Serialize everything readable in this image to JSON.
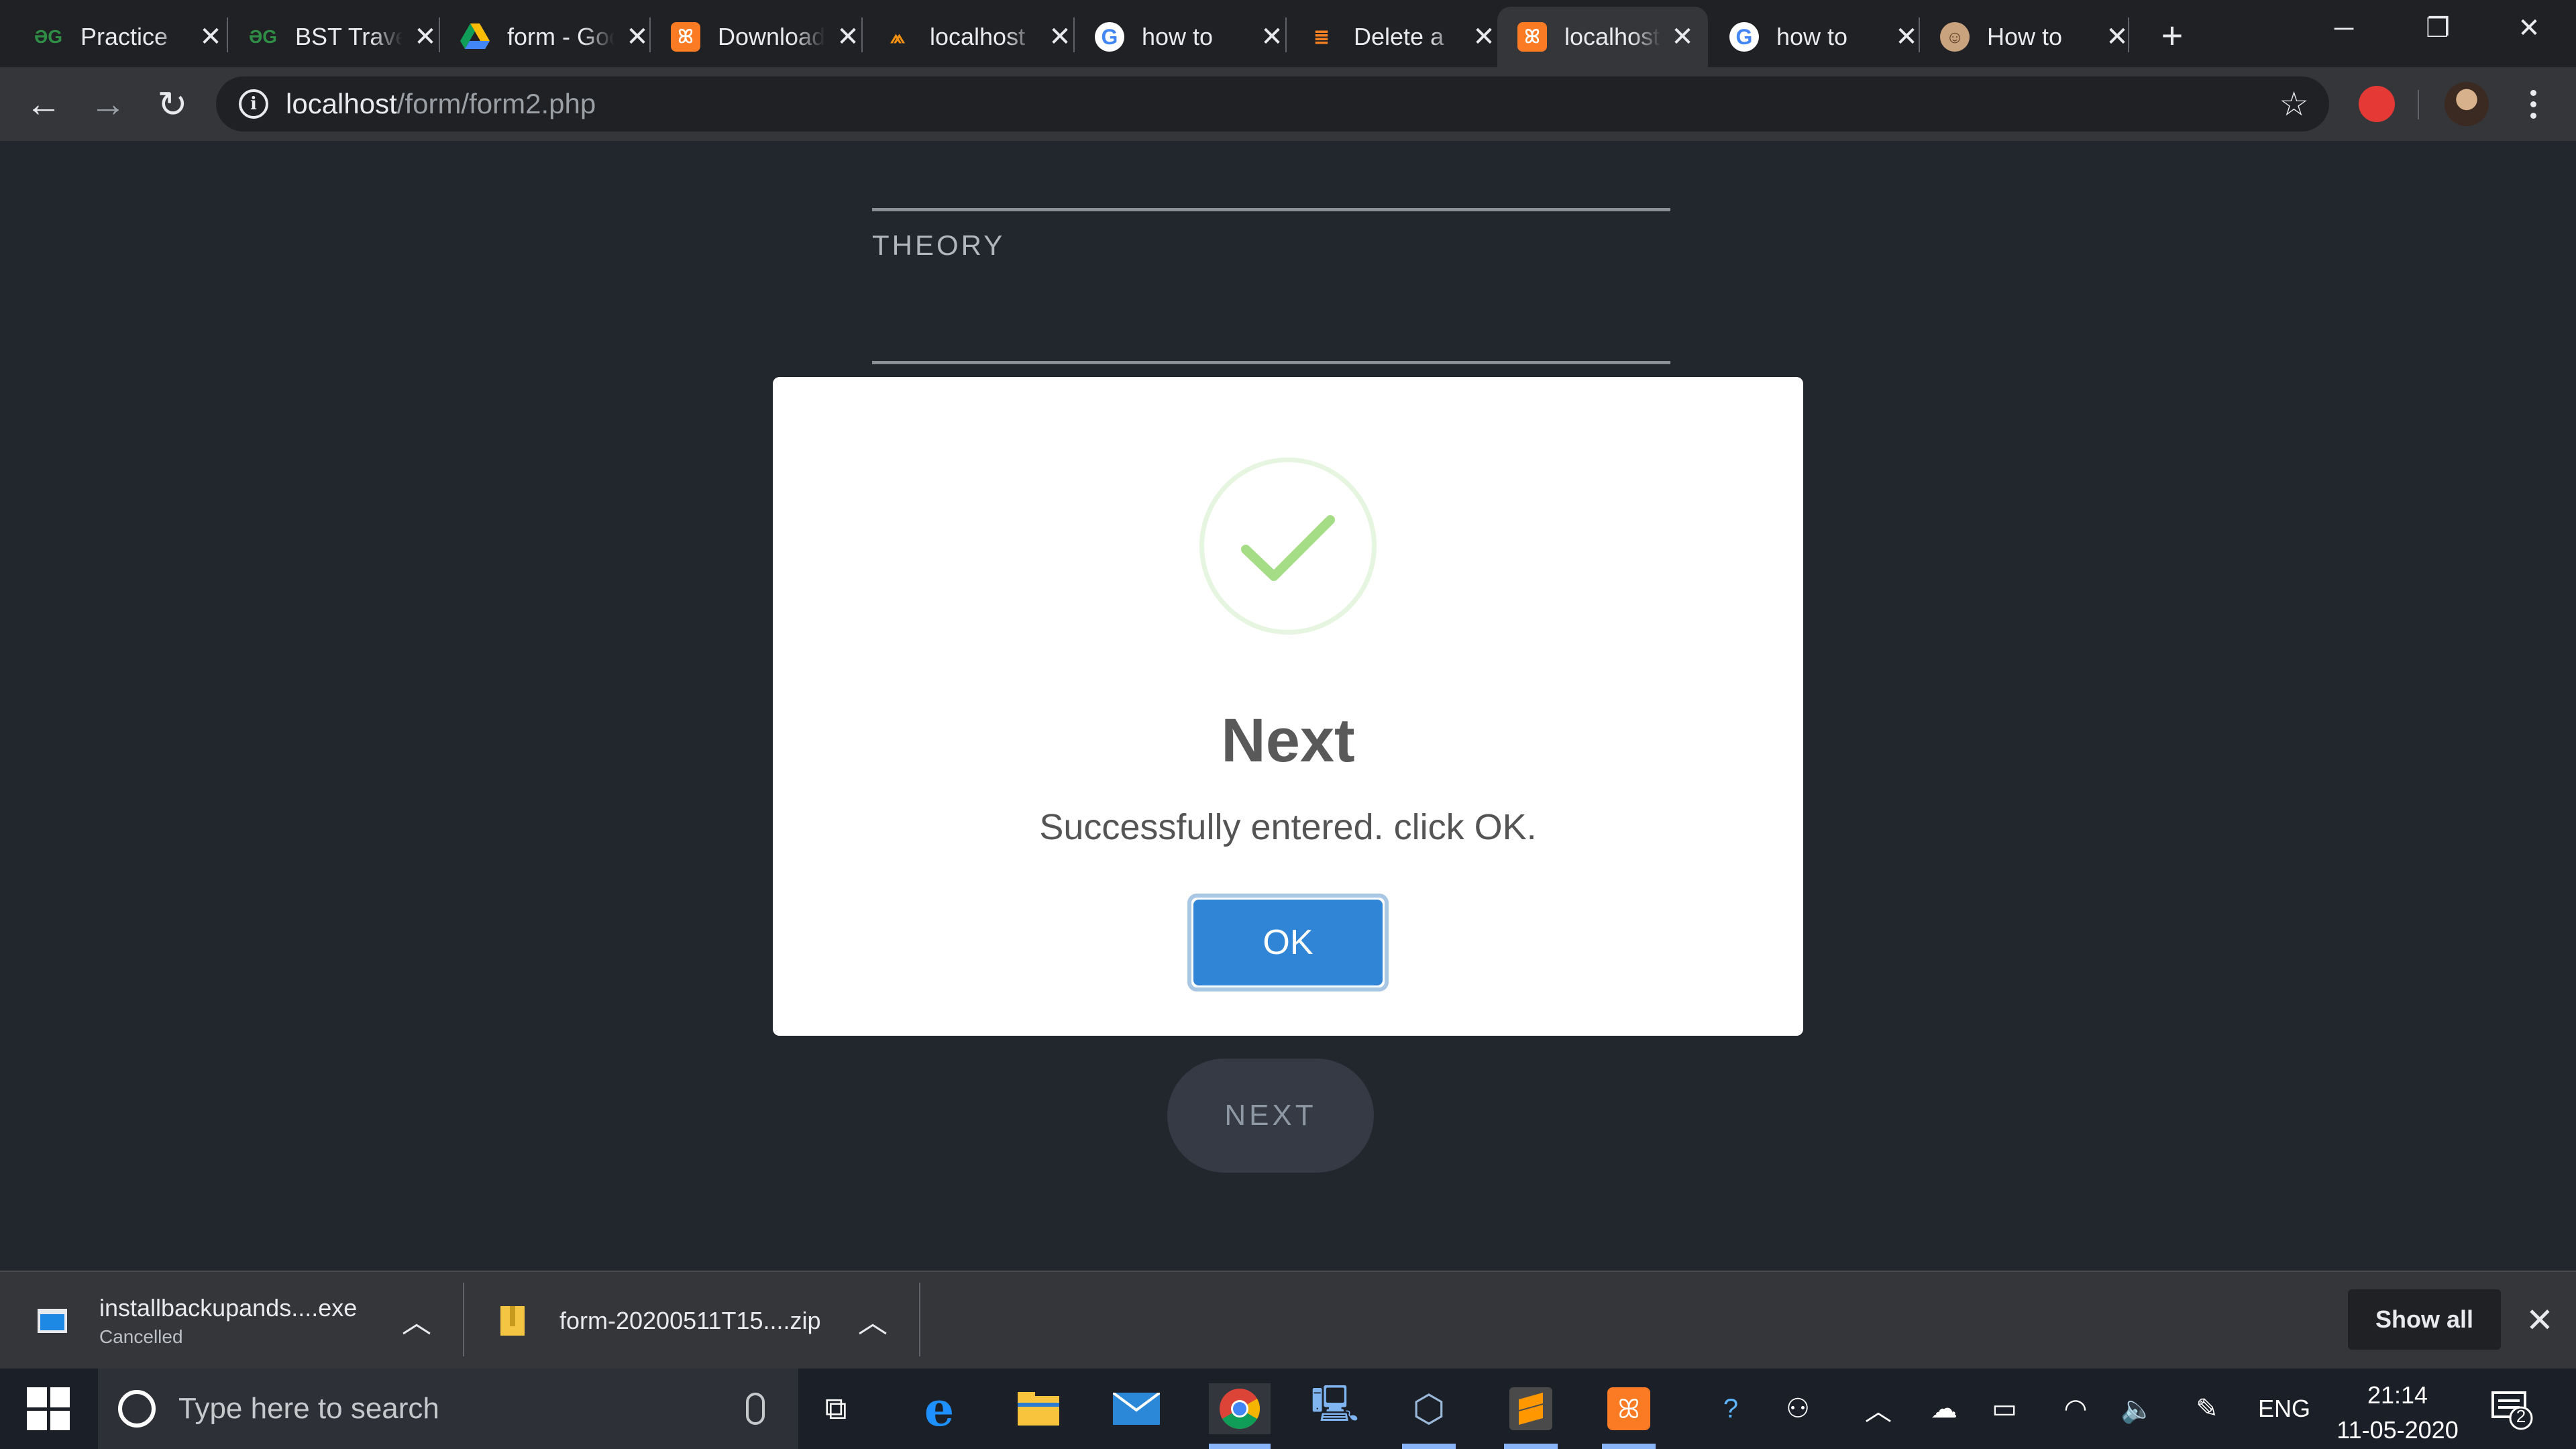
{
  "browser": {
    "tabs": [
      {
        "icon": "geeksforgeeks-icon",
        "label": "Practice",
        "active": false
      },
      {
        "icon": "geeksforgeeks-icon",
        "label": "BST Traversal",
        "active": false
      },
      {
        "icon": "google-drive-icon",
        "label": "form - Google Drive",
        "active": false
      },
      {
        "icon": "xampp-icon",
        "label": "Download",
        "active": false
      },
      {
        "icon": "phpmyadmin-icon",
        "label": "localhost",
        "active": false
      },
      {
        "icon": "google-icon",
        "label": "how to",
        "active": false
      },
      {
        "icon": "stackoverflow-icon",
        "label": "Delete a",
        "active": false
      },
      {
        "icon": "xampp-icon",
        "label": "localhost",
        "active": true
      },
      {
        "icon": "google-icon",
        "label": "how to",
        "active": false
      },
      {
        "icon": "cookie-icon",
        "label": "How to",
        "active": false
      }
    ],
    "url_host": "localhost",
    "url_path": "/form/form2.php"
  },
  "form": {
    "field_label": "THEORY",
    "next_label": "NEXT"
  },
  "dialog": {
    "title": "Next",
    "message": "Successfully entered. click OK.",
    "ok_label": "OK",
    "check_color": "#a5dc86"
  },
  "downloads": {
    "items": [
      {
        "name": "installbackupands....exe",
        "status": "Cancelled"
      },
      {
        "name": "form-20200511T15....zip",
        "status": ""
      }
    ],
    "show_all_label": "Show all"
  },
  "taskbar": {
    "search_placeholder": "Type here to search",
    "language": "ENG",
    "time": "21:14",
    "date": "11-05-2020",
    "notification_count": "2"
  }
}
